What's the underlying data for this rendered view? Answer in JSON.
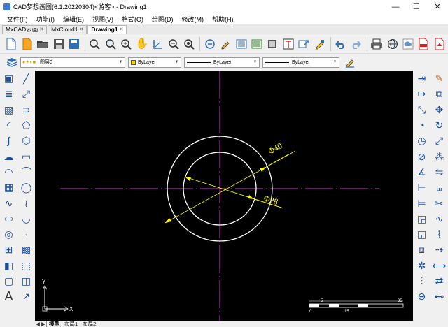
{
  "window": {
    "title": "CAD梦想画图(6.1.20220304)<游客> - Drawing1",
    "minimize": "—",
    "maximize": "☐",
    "close": "✕"
  },
  "menu": [
    "文件(F)",
    "功能(I)",
    "编辑(E)",
    "视图(V)",
    "格式(O)",
    "绘图(D)",
    "修改(M)",
    "帮助(H)"
  ],
  "tabs": [
    {
      "label": "MxCAD云画",
      "active": false
    },
    {
      "label": "MxCloud1",
      "active": false
    },
    {
      "label": "Drawing1",
      "active": true
    }
  ],
  "toolbar": {
    "icons": [
      "new-file-icon",
      "open-file-icon",
      "open-folder-icon",
      "save-icon",
      "save-as-icon",
      "zoom-window-icon",
      "zoom-realtime-icon",
      "zoom-extents-icon",
      "pan-hand-icon",
      "ucs-icon",
      "zoom-previous-icon",
      "zoom-all-icon",
      "zoom-out-icon",
      "match-properties-icon",
      "properties-icon",
      "layer-manager-icon",
      "block-icon",
      "text-style-icon",
      "file-transfer-icon",
      "brush-icon",
      "undo-icon",
      "redo-icon",
      "print-icon",
      "web-globe-icon",
      "cloud-icon",
      "pdf-icon",
      "pdf-export-icon"
    ]
  },
  "properties": {
    "layer": "图层0",
    "color": "ByLayer",
    "linetype": "ByLayer",
    "lineweight": "ByLayer",
    "color_swatch": "#ffd400"
  },
  "drawing": {
    "dim_outer": "Φ40",
    "dim_inner": "Φ28",
    "ucs_x": "X",
    "ucs_y": "Y",
    "scale_labels": [
      "0",
      "5",
      "15",
      "35"
    ]
  },
  "layouts": [
    "模型",
    "布局1",
    "布局2"
  ],
  "colors": {
    "canvas": "#000000",
    "circle": "#ffffff",
    "centerline": "#c040c0",
    "dimension": "#ffff00"
  }
}
